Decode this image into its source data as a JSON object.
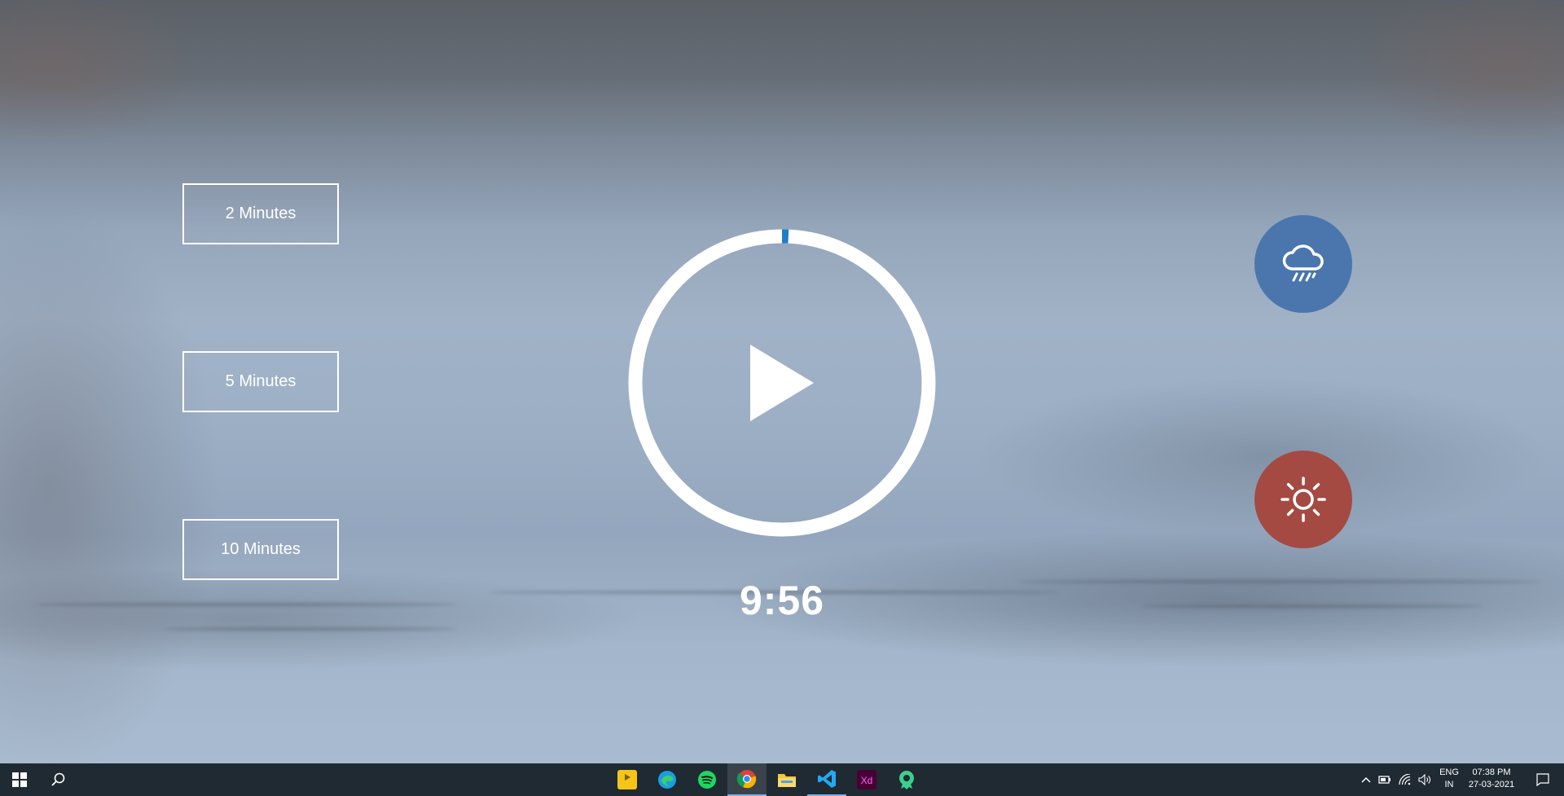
{
  "presets": [
    {
      "label": "2 Minutes"
    },
    {
      "label": "5 Minutes"
    },
    {
      "label": "10 Minutes"
    }
  ],
  "timer": {
    "display": "9:56",
    "progress": 0.007,
    "state_icon": "play-icon",
    "ring_color": "#ffffff",
    "progress_color": "#1f7fc4"
  },
  "sounds": [
    {
      "name": "rain",
      "icon": "rain-cloud-icon",
      "color": "#4a76ad"
    },
    {
      "name": "summer",
      "icon": "sun-icon",
      "color": "#a44a43"
    }
  ],
  "taskbar": {
    "apps": [
      {
        "name": "player",
        "icon": "player-icon",
        "label": "Player"
      },
      {
        "name": "edge",
        "icon": "edge-icon"
      },
      {
        "name": "spotify",
        "icon": "spotify-icon"
      },
      {
        "name": "chrome",
        "icon": "chrome-icon"
      },
      {
        "name": "file-explorer",
        "icon": "folder-icon"
      },
      {
        "name": "vscode",
        "icon": "vscode-icon"
      },
      {
        "name": "adobe-xd",
        "icon": "xd-icon",
        "label": "Xd"
      },
      {
        "name": "green-app",
        "icon": "green-app-icon"
      }
    ],
    "tray": {
      "language": "ENG",
      "region": "IN",
      "time": "07:38 PM",
      "date": "27-03-2021"
    }
  }
}
